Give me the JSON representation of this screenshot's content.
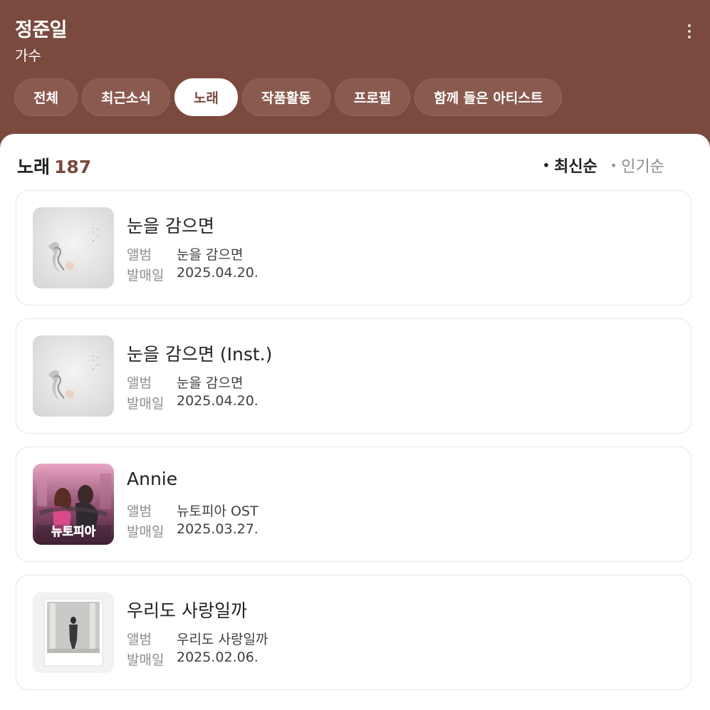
{
  "header": {
    "artist_name": "정준일",
    "artist_role": "가수"
  },
  "tabs": [
    {
      "label": "전체",
      "active": false
    },
    {
      "label": "최근소식",
      "active": false
    },
    {
      "label": "노래",
      "active": true
    },
    {
      "label": "작품활동",
      "active": false
    },
    {
      "label": "프로필",
      "active": false
    },
    {
      "label": "함께 들은 아티스트",
      "active": false
    }
  ],
  "songs_section": {
    "title": "노래",
    "count": "187",
    "sort_options": [
      {
        "label": "최신순",
        "active": true
      },
      {
        "label": "인기순",
        "active": false
      }
    ]
  },
  "meta_labels": {
    "album": "앨범",
    "release_date": "발매일"
  },
  "songs": [
    {
      "title": "눈을 감으면",
      "album": "눈을 감으면",
      "release_date": "2025.04.20.",
      "cover": "snow-sketch-cover"
    },
    {
      "title": "눈을 감으면 (Inst.)",
      "album": "눈을 감으면",
      "release_date": "2025.04.20.",
      "cover": "snow-sketch-cover"
    },
    {
      "title": "Annie",
      "album": "뉴토피아 OST",
      "release_date": "2025.03.27.",
      "cover": "newtopia-poster-cover"
    },
    {
      "title": "우리도 사랑일까",
      "album": "우리도 사랑일까",
      "release_date": "2025.02.06.",
      "cover": "polaroid-photo-cover"
    }
  ],
  "colors": {
    "header_bg": "#7a4a3e",
    "accent": "#7a4a3e"
  }
}
